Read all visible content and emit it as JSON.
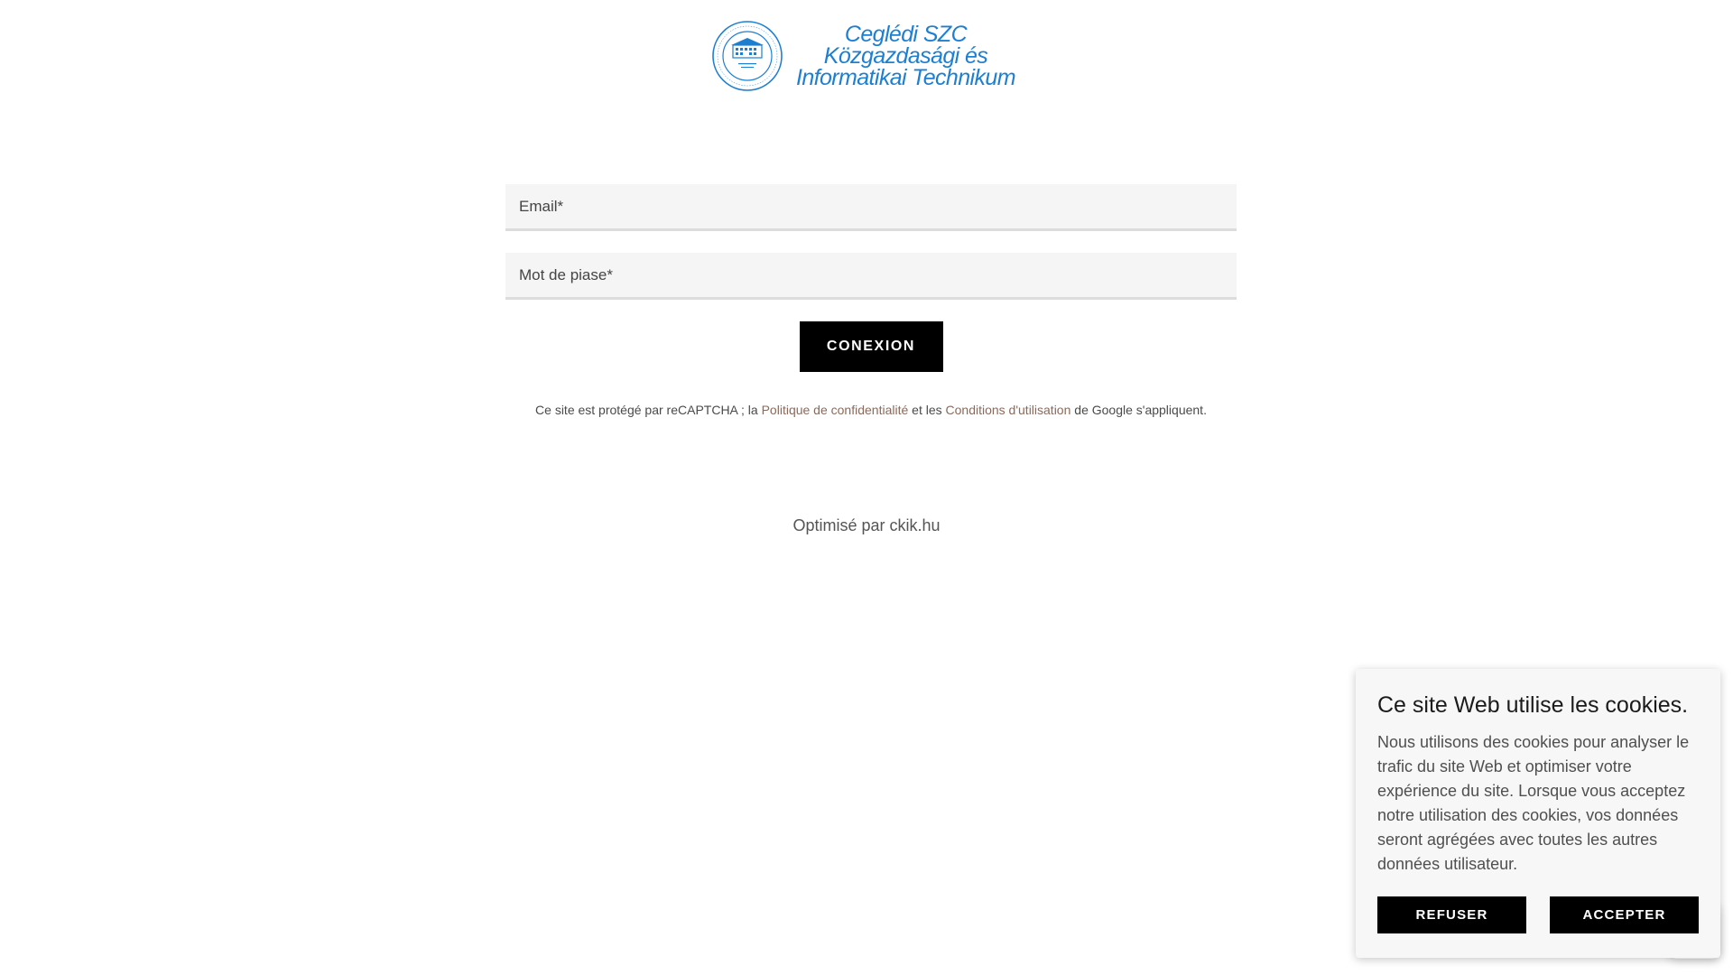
{
  "header": {
    "logo_lines": [
      "Ceglédi SZC",
      "Közgazdasági és",
      "Informatikai Technikum"
    ],
    "seal_text": "Ceglédi SZC Közgazdasági és Informatikai Technikum",
    "seal_icon": "school-seal-icon"
  },
  "login_form": {
    "email_placeholder": "Email*",
    "password_placeholder": "Mot de piase*",
    "submit_label": "CONEXION"
  },
  "recaptcha": {
    "prefix": "Ce site est protégé par reCAPTCHA ; la ",
    "privacy_link": "Politique de confidentialité",
    "middle": " et les ",
    "terms_link": "Conditions d'utilisation",
    "suffix": " de Google s'appliquent."
  },
  "footer": {
    "powered_by": "Optimisé par ckik.hu"
  },
  "cookie_banner": {
    "title": "Ce site Web utilise les cookies.",
    "body": "Nous utilisons des cookies pour analyser le trafic du site Web et optimiser votre expérience du site. Lorsque vous acceptez notre utilisation des cookies, vos données seront agrégées avec toutes les autres données utilisateur.",
    "decline_label": "REFUSER",
    "accept_label": "ACCEPTER"
  },
  "colors": {
    "logo_blue": "#1d7fd1",
    "link_brown": "#8a6a5b",
    "button_black": "#000000"
  }
}
